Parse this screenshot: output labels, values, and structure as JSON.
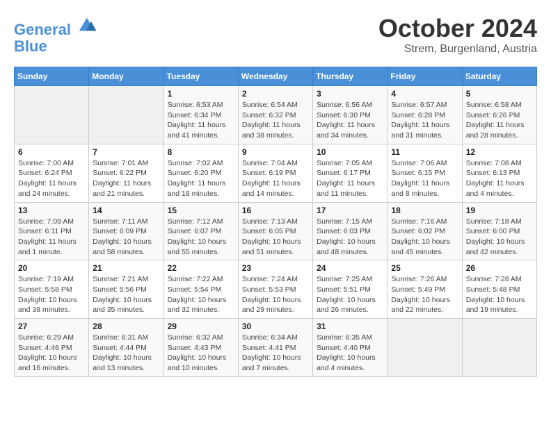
{
  "header": {
    "logo_line1": "General",
    "logo_line2": "Blue",
    "month": "October 2024",
    "location": "Strem, Burgenland, Austria"
  },
  "weekdays": [
    "Sunday",
    "Monday",
    "Tuesday",
    "Wednesday",
    "Thursday",
    "Friday",
    "Saturday"
  ],
  "weeks": [
    [
      {
        "day": "",
        "empty": true
      },
      {
        "day": "",
        "empty": true
      },
      {
        "day": "1",
        "sunrise": "6:53 AM",
        "sunset": "6:34 PM",
        "daylight": "11 hours and 41 minutes."
      },
      {
        "day": "2",
        "sunrise": "6:54 AM",
        "sunset": "6:32 PM",
        "daylight": "11 hours and 38 minutes."
      },
      {
        "day": "3",
        "sunrise": "6:56 AM",
        "sunset": "6:30 PM",
        "daylight": "11 hours and 34 minutes."
      },
      {
        "day": "4",
        "sunrise": "6:57 AM",
        "sunset": "6:28 PM",
        "daylight": "11 hours and 31 minutes."
      },
      {
        "day": "5",
        "sunrise": "6:58 AM",
        "sunset": "6:26 PM",
        "daylight": "11 hours and 28 minutes."
      }
    ],
    [
      {
        "day": "6",
        "sunrise": "7:00 AM",
        "sunset": "6:24 PM",
        "daylight": "11 hours and 24 minutes."
      },
      {
        "day": "7",
        "sunrise": "7:01 AM",
        "sunset": "6:22 PM",
        "daylight": "11 hours and 21 minutes."
      },
      {
        "day": "8",
        "sunrise": "7:02 AM",
        "sunset": "6:20 PM",
        "daylight": "11 hours and 18 minutes."
      },
      {
        "day": "9",
        "sunrise": "7:04 AM",
        "sunset": "6:19 PM",
        "daylight": "11 hours and 14 minutes."
      },
      {
        "day": "10",
        "sunrise": "7:05 AM",
        "sunset": "6:17 PM",
        "daylight": "11 hours and 11 minutes."
      },
      {
        "day": "11",
        "sunrise": "7:06 AM",
        "sunset": "6:15 PM",
        "daylight": "11 hours and 8 minutes."
      },
      {
        "day": "12",
        "sunrise": "7:08 AM",
        "sunset": "6:13 PM",
        "daylight": "11 hours and 4 minutes."
      }
    ],
    [
      {
        "day": "13",
        "sunrise": "7:09 AM",
        "sunset": "6:11 PM",
        "daylight": "11 hours and 1 minute."
      },
      {
        "day": "14",
        "sunrise": "7:11 AM",
        "sunset": "6:09 PM",
        "daylight": "10 hours and 58 minutes."
      },
      {
        "day": "15",
        "sunrise": "7:12 AM",
        "sunset": "6:07 PM",
        "daylight": "10 hours and 55 minutes."
      },
      {
        "day": "16",
        "sunrise": "7:13 AM",
        "sunset": "6:05 PM",
        "daylight": "10 hours and 51 minutes."
      },
      {
        "day": "17",
        "sunrise": "7:15 AM",
        "sunset": "6:03 PM",
        "daylight": "10 hours and 48 minutes."
      },
      {
        "day": "18",
        "sunrise": "7:16 AM",
        "sunset": "6:02 PM",
        "daylight": "10 hours and 45 minutes."
      },
      {
        "day": "19",
        "sunrise": "7:18 AM",
        "sunset": "6:00 PM",
        "daylight": "10 hours and 42 minutes."
      }
    ],
    [
      {
        "day": "20",
        "sunrise": "7:19 AM",
        "sunset": "5:58 PM",
        "daylight": "10 hours and 38 minutes."
      },
      {
        "day": "21",
        "sunrise": "7:21 AM",
        "sunset": "5:56 PM",
        "daylight": "10 hours and 35 minutes."
      },
      {
        "day": "22",
        "sunrise": "7:22 AM",
        "sunset": "5:54 PM",
        "daylight": "10 hours and 32 minutes."
      },
      {
        "day": "23",
        "sunrise": "7:24 AM",
        "sunset": "5:53 PM",
        "daylight": "10 hours and 29 minutes."
      },
      {
        "day": "24",
        "sunrise": "7:25 AM",
        "sunset": "5:51 PM",
        "daylight": "10 hours and 26 minutes."
      },
      {
        "day": "25",
        "sunrise": "7:26 AM",
        "sunset": "5:49 PM",
        "daylight": "10 hours and 22 minutes."
      },
      {
        "day": "26",
        "sunrise": "7:28 AM",
        "sunset": "5:48 PM",
        "daylight": "10 hours and 19 minutes."
      }
    ],
    [
      {
        "day": "27",
        "sunrise": "6:29 AM",
        "sunset": "4:46 PM",
        "daylight": "10 hours and 16 minutes."
      },
      {
        "day": "28",
        "sunrise": "6:31 AM",
        "sunset": "4:44 PM",
        "daylight": "10 hours and 13 minutes."
      },
      {
        "day": "29",
        "sunrise": "6:32 AM",
        "sunset": "4:43 PM",
        "daylight": "10 hours and 10 minutes."
      },
      {
        "day": "30",
        "sunrise": "6:34 AM",
        "sunset": "4:41 PM",
        "daylight": "10 hours and 7 minutes."
      },
      {
        "day": "31",
        "sunrise": "6:35 AM",
        "sunset": "4:40 PM",
        "daylight": "10 hours and 4 minutes."
      },
      {
        "day": "",
        "empty": true
      },
      {
        "day": "",
        "empty": true
      }
    ]
  ]
}
